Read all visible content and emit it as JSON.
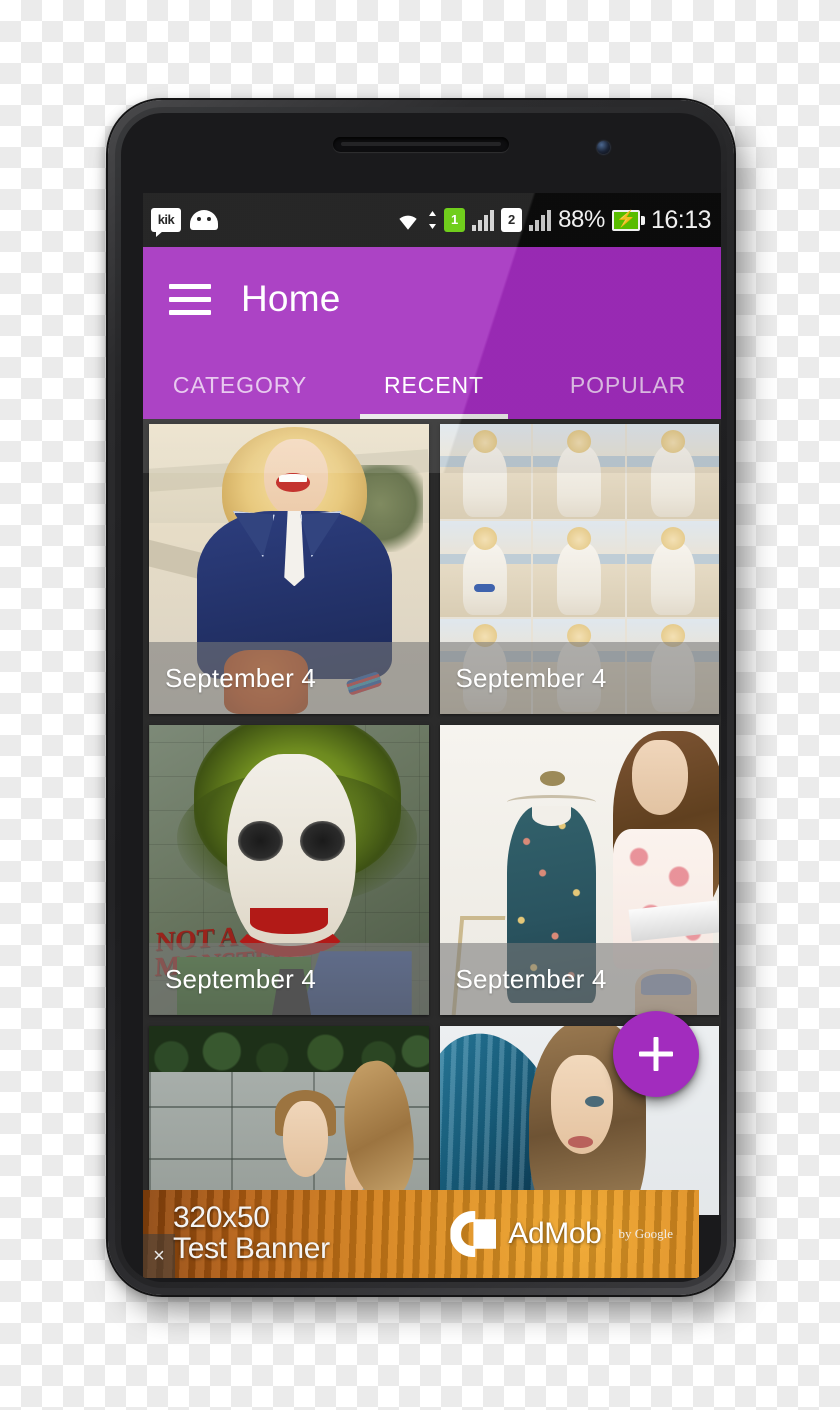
{
  "device": {
    "type": "android-smartphone",
    "bezel_color": "#2c2c2e"
  },
  "status_bar": {
    "background": "#0c0c0c",
    "notification_icons": [
      {
        "name": "kik-icon",
        "label": "kik"
      },
      {
        "name": "android-icon",
        "label": ""
      }
    ],
    "wifi": "wifi-icon",
    "data_transfer": "up-down-arrows-icon",
    "sim1_label": "1",
    "sim1_color": "#5ec800",
    "sim2_label": "2",
    "battery_percent": "88%",
    "battery_state": "charging",
    "clock": "16:13"
  },
  "appbar": {
    "background": "#a22cbe",
    "menu_icon": "hamburger-menu-icon",
    "title": "Home"
  },
  "tabs": [
    {
      "label": "CATEGORY",
      "active": false
    },
    {
      "label": "RECENT",
      "active": true
    },
    {
      "label": "POPULAR",
      "active": false
    }
  ],
  "gallery": {
    "cards": [
      {
        "caption": "September 4",
        "art": "blonde-woman-navy-polo"
      },
      {
        "caption": "September 4",
        "art": "beach-photo-collage"
      },
      {
        "caption": "September 4",
        "art": "joker-green-hair"
      },
      {
        "caption": "September 4",
        "art": "floral-dress-and-woman"
      },
      {
        "caption": "",
        "art": "woman-concrete-wall"
      },
      {
        "caption": "",
        "art": "blue-balloon-woman"
      }
    ]
  },
  "fab": {
    "icon": "plus-icon",
    "color": "#a22cbe"
  },
  "ad_banner": {
    "close_label": "×",
    "line1": "320x50",
    "line2": "Test Banner",
    "brand": "AdMob",
    "brand_suffix": "by Google"
  }
}
